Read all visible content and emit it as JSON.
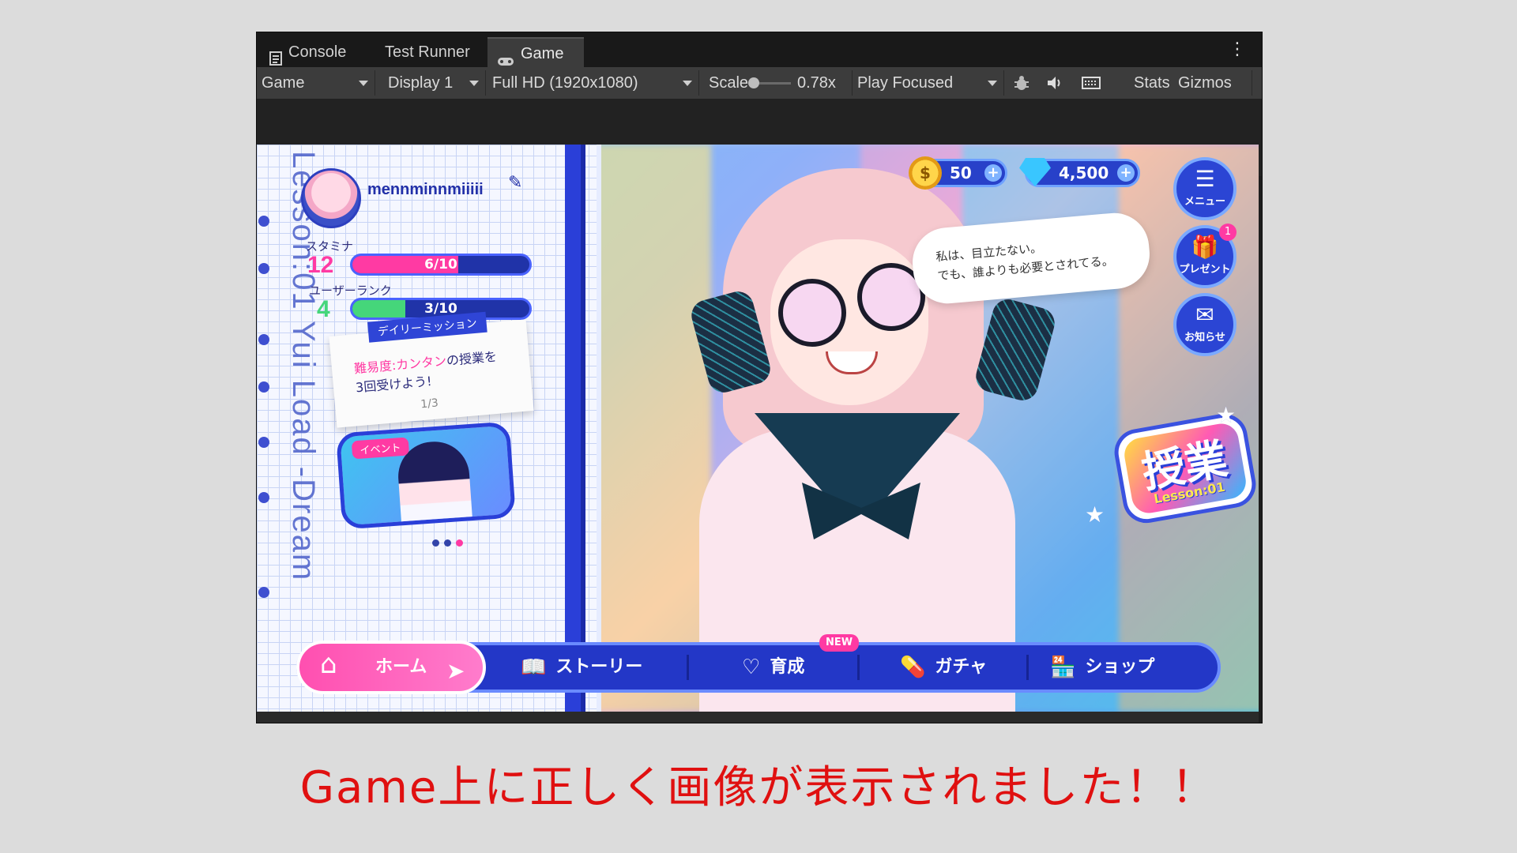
{
  "tabs": {
    "console": "Console",
    "test_runner": "Test Runner",
    "game": "Game"
  },
  "toolbar": {
    "view_select": "Game",
    "display_select": "Display 1",
    "resolution_select": "Full HD (1920x1080)",
    "scale_label": "Scale",
    "scale_value": "0.78x",
    "play_mode_select": "Play Focused",
    "stats": "Stats",
    "gizmos": "Gizmos"
  },
  "game": {
    "vertical_text": "Lesson:01 Yui Load -Dream",
    "profile": {
      "username": "mennminnmiiiii"
    },
    "stamina": {
      "label": "スタミナ",
      "level": "12",
      "bar_text": "6/10",
      "fraction": 0.6
    },
    "rank": {
      "label": "ユーザーランク",
      "level": "4",
      "bar_text": "3/10",
      "fraction": 0.3
    },
    "daily_mission": {
      "tag": "デイリーミッション",
      "highlight": "難易度:カンタン",
      "text_rest": "の授業を",
      "line2": "3回受けよう!",
      "progress": "1/3"
    },
    "event": {
      "tag": "イベント"
    },
    "speech": {
      "line1": "私は、目立たない。",
      "line2": "でも、誰よりも必要とされてる。"
    },
    "currency": {
      "coins": "50",
      "gems": "4,500"
    },
    "side_buttons": {
      "menu": "メニュー",
      "present": "プレゼント",
      "present_badge": "1",
      "notice": "お知らせ"
    },
    "lesson_button": {
      "title": "授業",
      "subtitle": "Lesson:01"
    },
    "nav": {
      "home": "ホーム",
      "story": "ストーリー",
      "training": "育成",
      "training_badge": "NEW",
      "gacha": "ガチャ",
      "shop": "ショップ"
    }
  },
  "caption": "Game上に正しく画像が表示されました！！",
  "colors": {
    "caption": "#e01010",
    "stamina_fill": "#ff3aa3",
    "rank_fill": "#45d67a",
    "accent_blue": "#2337c7"
  }
}
